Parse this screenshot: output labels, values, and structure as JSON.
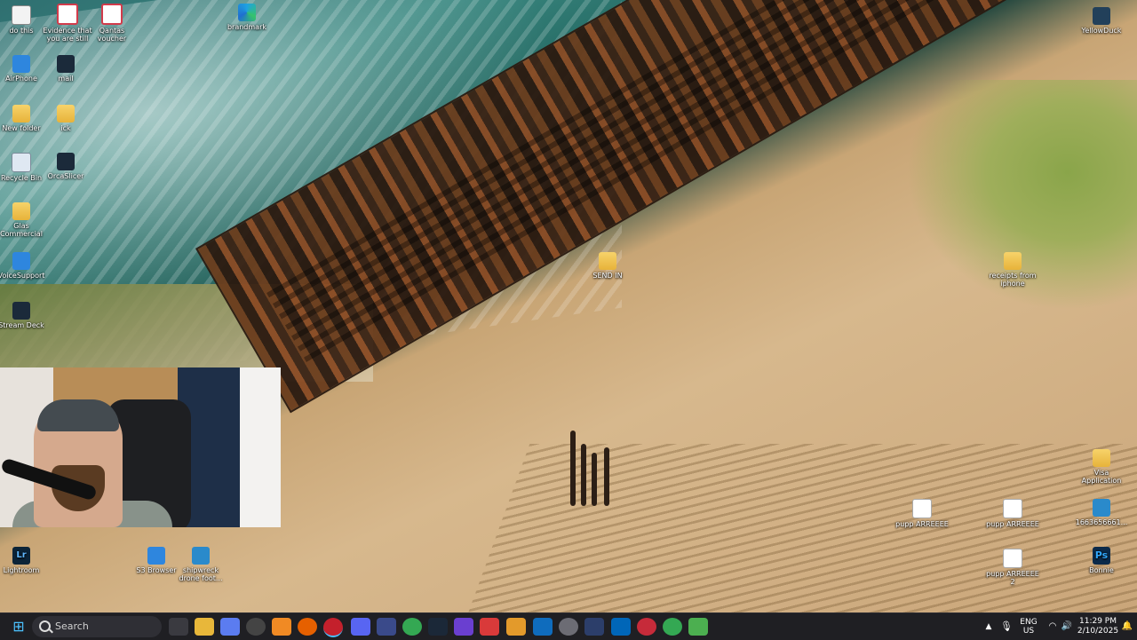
{
  "desktop": {
    "icons": [
      {
        "label": "do this",
        "icon": "file-icon"
      },
      {
        "label": "Evidence that you are still",
        "icon": "opera-icon"
      },
      {
        "label": "Qantas voucher",
        "icon": "opera-icon"
      },
      {
        "label": "brandmark",
        "icon": "edge-icon"
      },
      {
        "label": "YellowDuck",
        "icon": "app-icon"
      },
      {
        "label": "AirPhone",
        "icon": "app-icon"
      },
      {
        "label": "mail",
        "icon": "app-icon"
      },
      {
        "label": "New folder",
        "icon": "folder-icon"
      },
      {
        "label": "ick",
        "icon": "folder-icon"
      },
      {
        "label": "Recycle Bin",
        "icon": "recycle-bin-icon"
      },
      {
        "label": "OrcaSlicer",
        "icon": "app-icon"
      },
      {
        "label": "Glas Commercial",
        "icon": "folder-icon"
      },
      {
        "label": "VoiceSupport",
        "icon": "app-icon"
      },
      {
        "label": "Stream Deck",
        "icon": "stream-deck-icon"
      },
      {
        "label": "SEND IN",
        "icon": "folder-icon"
      },
      {
        "label": "receipts from iphone",
        "icon": "folder-icon"
      },
      {
        "label": "Visa Application",
        "icon": "folder-icon"
      },
      {
        "label": "Lightroom",
        "icon": "lightroom-icon"
      },
      {
        "label": "S3 Browser",
        "icon": "app-icon"
      },
      {
        "label": "shipwreck drone foot...",
        "icon": "video-icon"
      },
      {
        "label": "pupp ARREEEE",
        "icon": "document-icon"
      },
      {
        "label": "pupp ARREEEE",
        "icon": "document-icon"
      },
      {
        "label": "1663656661...",
        "icon": "image-icon"
      },
      {
        "label": "pupp ARREEEE 2",
        "icon": "document-icon"
      },
      {
        "label": "Bonnie",
        "icon": "photoshop-icon"
      }
    ]
  },
  "taskbar": {
    "search_label": "Search",
    "apps": [
      "windows-start",
      "file-explorer",
      "task-view",
      "copilot",
      "browser",
      "obs",
      "vlc",
      "firefox",
      "opera",
      "discord",
      "app",
      "chrome",
      "steam",
      "app",
      "app",
      "outlook",
      "app",
      "app",
      "vscode",
      "app",
      "chrome",
      "notepad"
    ],
    "tray": {
      "language_top": "ENG",
      "language_bottom": "US",
      "time": "11:29 PM",
      "date": "2/10/2025"
    }
  },
  "colors": {
    "taskbar_bg": "#1f1f23",
    "accent": "#2e86de"
  }
}
